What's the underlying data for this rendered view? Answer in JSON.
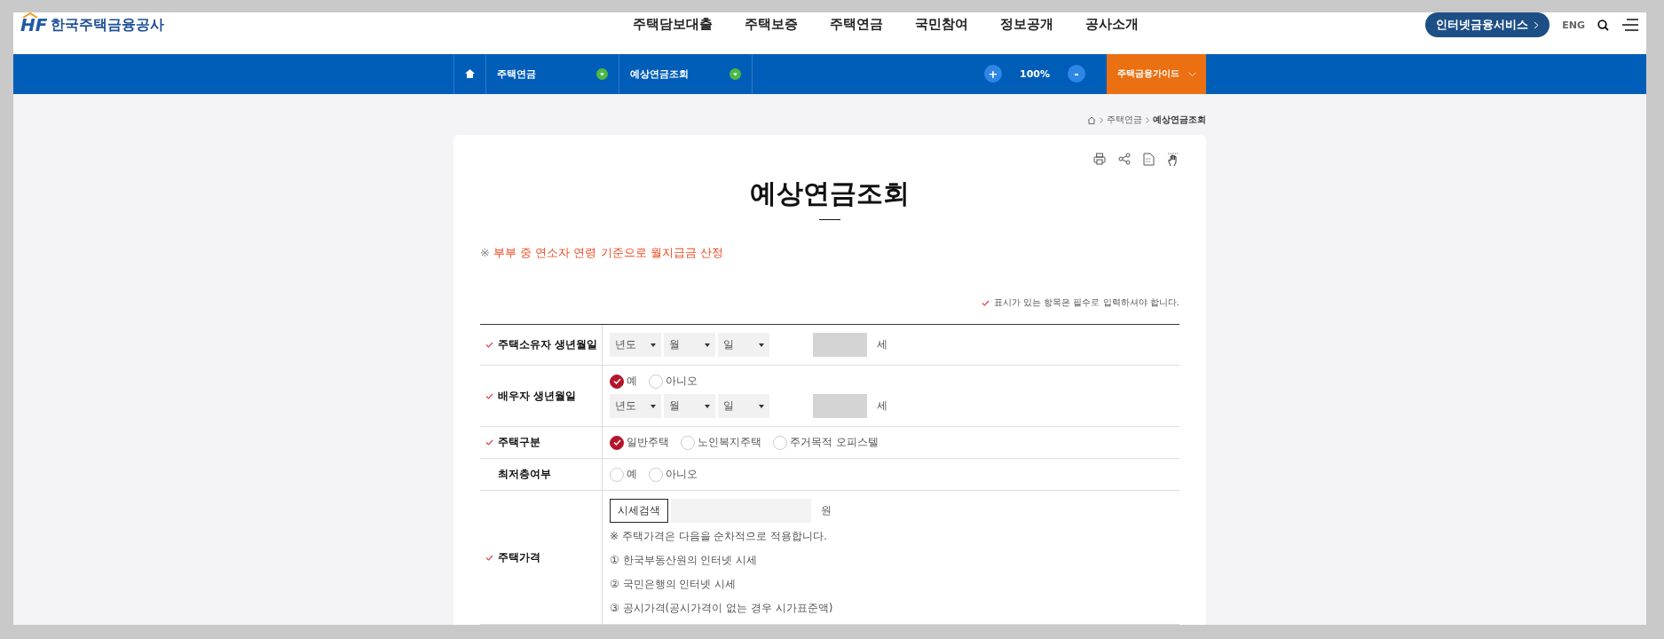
{
  "header": {
    "logo_mark": "HF",
    "logo_text": "한국주택금융공사",
    "nav": [
      "주택담보대출",
      "주택보증",
      "주택연금",
      "국민참여",
      "정보공개",
      "공사소개"
    ],
    "service_button": "인터넷금융서비스",
    "lang": "ENG"
  },
  "subbar": {
    "crumbs": [
      {
        "label": "주택연금"
      },
      {
        "label": "예상연금조회"
      }
    ],
    "zoom_in": "+",
    "zoom_level": "100%",
    "zoom_out": "-",
    "guide": "주택금융가이드"
  },
  "breadcrumb": [
    "주택연금",
    "예상연금조회"
  ],
  "page": {
    "title": "예상연금조회",
    "note_mark": "※",
    "note": "부부 중 연소자 연령 기준으로 월지급금 산정",
    "required_note": "표시가 있는 항목은 필수로 입력하셔야 합니다."
  },
  "form": [
    {
      "kind": "date",
      "label": "주택소유자 생년월일",
      "required": true,
      "selects": [
        "년도",
        "월",
        "일"
      ],
      "unit": "세"
    },
    {
      "kind": "radio_date",
      "label": "배우자 생년월일",
      "required": true,
      "options": [
        {
          "label": "예",
          "selected": true
        },
        {
          "label": "아니오",
          "selected": false
        }
      ],
      "selects": [
        "년도",
        "월",
        "일"
      ],
      "unit": "세"
    },
    {
      "kind": "radio",
      "label": "주택구분",
      "required": true,
      "options": [
        {
          "label": "일반주택",
          "selected": true
        },
        {
          "label": "노인복지주택",
          "selected": false
        },
        {
          "label": "주거목적 오피스텔",
          "selected": false
        }
      ]
    },
    {
      "kind": "radio",
      "label": "최저층여부",
      "required": false,
      "options": [
        {
          "label": "예",
          "selected": false
        },
        {
          "label": "아니오",
          "selected": false
        }
      ]
    },
    {
      "kind": "price",
      "label": "주택가격",
      "required": true,
      "button": "시세검색",
      "unit": "원",
      "notes": [
        "※ 주택가격은 다음을 순차적으로 적용합니다.",
        "① 한국부동산원의 인터넷 시세",
        "② 국민은행의 인터넷 시세",
        "③ 공시가격(공시가격이 없는 경우 시가표준액)"
      ]
    }
  ]
}
